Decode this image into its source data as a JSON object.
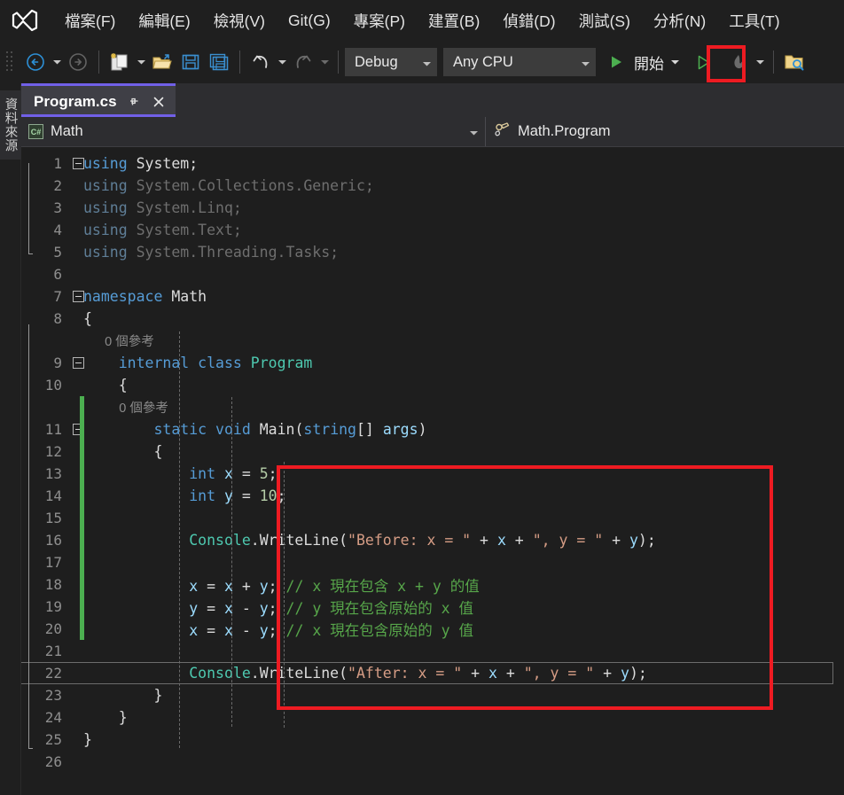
{
  "app": {
    "title": "Visual Studio",
    "logo_icon": "visual-studio-logo"
  },
  "menubar": {
    "items": [
      {
        "label": "檔案(F)"
      },
      {
        "label": "編輯(E)"
      },
      {
        "label": "檢視(V)"
      },
      {
        "label": "Git(G)"
      },
      {
        "label": "專案(P)"
      },
      {
        "label": "建置(B)"
      },
      {
        "label": "偵錯(D)"
      },
      {
        "label": "測試(S)"
      },
      {
        "label": "分析(N)"
      },
      {
        "label": "工具(T)"
      }
    ]
  },
  "toolbar": {
    "grip_icon": "drag-grip-icon",
    "nav_back_icon": "navigate-back-icon",
    "nav_forward_icon": "navigate-forward-icon",
    "new_item_icon": "new-item-icon",
    "open_file_icon": "open-file-icon",
    "save_icon": "save-icon",
    "save_all_icon": "save-all-icon",
    "undo_icon": "undo-icon",
    "redo_icon": "redo-icon",
    "configuration": {
      "label": "Debug",
      "caret_icon": "chevron-down-icon"
    },
    "platform": {
      "label": "Any CPU",
      "caret_icon": "chevron-down-icon"
    },
    "start_debug": {
      "label": "開始",
      "icon": "play-filled-icon",
      "caret_icon": "chevron-down-icon"
    },
    "start_no_debug": {
      "icon": "play-outline-icon",
      "highlighted": true
    },
    "hot_reload": {
      "icon": "hot-reload-flame-icon",
      "caret_icon": "chevron-down-icon"
    },
    "solution_search_icon": "folder-search-icon"
  },
  "highlights": {
    "accent_color": "#ee1b22",
    "run_button_box": "start-without-debugging",
    "code_box": "swap-algorithm-code"
  },
  "sidebar": {
    "vertical_tab_label": "資料來源"
  },
  "tab": {
    "filename": "Program.cs",
    "pin_icon": "pin-icon",
    "close_icon": "close-icon",
    "accent_color": "#7160e8"
  },
  "breadcrumb": {
    "left": {
      "badge": "C#",
      "label": "Math",
      "caret_icon": "chevron-down-icon"
    },
    "right": {
      "icon": "method-class-icon",
      "label": "Math.Program"
    }
  },
  "editor": {
    "background": "#1e1e1e",
    "change_bar_color": "#4caf50",
    "current_line": 22,
    "lines": [
      {
        "n": "1",
        "tokens": [
          {
            "t": "using",
            "c": "kw"
          },
          {
            "t": " System;",
            "c": "plain"
          }
        ]
      },
      {
        "n": "2",
        "tokens": [
          {
            "t": "using",
            "c": "dim"
          },
          {
            "t": " System.Collections.Generic;",
            "c": "dimw"
          }
        ]
      },
      {
        "n": "3",
        "tokens": [
          {
            "t": "using",
            "c": "dim"
          },
          {
            "t": " System.Linq;",
            "c": "dimw"
          }
        ]
      },
      {
        "n": "4",
        "tokens": [
          {
            "t": "using",
            "c": "dim"
          },
          {
            "t": " System.Text;",
            "c": "dimw"
          }
        ]
      },
      {
        "n": "5",
        "tokens": [
          {
            "t": "using",
            "c": "dim"
          },
          {
            "t": " System.Threading.Tasks;",
            "c": "dimw"
          }
        ]
      },
      {
        "n": "6",
        "tokens": []
      },
      {
        "n": "7",
        "tokens": [
          {
            "t": "namespace",
            "c": "kw"
          },
          {
            "t": " Math",
            "c": "plain"
          }
        ]
      },
      {
        "n": "8",
        "tokens": [
          {
            "t": "{",
            "c": "punc"
          }
        ]
      },
      {
        "n": "",
        "codelens": "0 個參考"
      },
      {
        "n": "9",
        "tokens": [
          {
            "t": "    ",
            "c": "plain"
          },
          {
            "t": "internal",
            "c": "kw"
          },
          {
            "t": " ",
            "c": "plain"
          },
          {
            "t": "class",
            "c": "kw"
          },
          {
            "t": " ",
            "c": "plain"
          },
          {
            "t": "Program",
            "c": "type"
          }
        ]
      },
      {
        "n": "10",
        "tokens": [
          {
            "t": "    {",
            "c": "punc"
          }
        ]
      },
      {
        "n": "",
        "codelens": "0 個參考",
        "indent": 2
      },
      {
        "n": "11",
        "tokens": [
          {
            "t": "        ",
            "c": "plain"
          },
          {
            "t": "static",
            "c": "kw"
          },
          {
            "t": " ",
            "c": "plain"
          },
          {
            "t": "void",
            "c": "kw"
          },
          {
            "t": " Main(",
            "c": "plain"
          },
          {
            "t": "string",
            "c": "kw"
          },
          {
            "t": "[] ",
            "c": "plain"
          },
          {
            "t": "args",
            "c": "id"
          },
          {
            "t": ")",
            "c": "plain"
          }
        ]
      },
      {
        "n": "12",
        "tokens": [
          {
            "t": "        {",
            "c": "punc"
          }
        ]
      },
      {
        "n": "13",
        "tokens": [
          {
            "t": "            ",
            "c": "plain"
          },
          {
            "t": "int",
            "c": "kw"
          },
          {
            "t": " ",
            "c": "plain"
          },
          {
            "t": "x",
            "c": "id"
          },
          {
            "t": " = ",
            "c": "plain"
          },
          {
            "t": "5",
            "c": "num"
          },
          {
            "t": ";",
            "c": "plain"
          }
        ]
      },
      {
        "n": "14",
        "tokens": [
          {
            "t": "            ",
            "c": "plain"
          },
          {
            "t": "int",
            "c": "kw"
          },
          {
            "t": " ",
            "c": "plain"
          },
          {
            "t": "y",
            "c": "id"
          },
          {
            "t": " = ",
            "c": "plain"
          },
          {
            "t": "10",
            "c": "num"
          },
          {
            "t": ";",
            "c": "plain"
          }
        ]
      },
      {
        "n": "15",
        "tokens": []
      },
      {
        "n": "16",
        "tokens": [
          {
            "t": "            ",
            "c": "plain"
          },
          {
            "t": "Console",
            "c": "type"
          },
          {
            "t": ".WriteLine(",
            "c": "plain"
          },
          {
            "t": "\"Before: x = \"",
            "c": "str"
          },
          {
            "t": " + ",
            "c": "plain"
          },
          {
            "t": "x",
            "c": "id"
          },
          {
            "t": " + ",
            "c": "plain"
          },
          {
            "t": "\", y = \"",
            "c": "str"
          },
          {
            "t": " + ",
            "c": "plain"
          },
          {
            "t": "y",
            "c": "id"
          },
          {
            "t": ");",
            "c": "plain"
          }
        ]
      },
      {
        "n": "17",
        "tokens": []
      },
      {
        "n": "18",
        "tokens": [
          {
            "t": "            ",
            "c": "plain"
          },
          {
            "t": "x",
            "c": "id"
          },
          {
            "t": " = ",
            "c": "plain"
          },
          {
            "t": "x",
            "c": "id"
          },
          {
            "t": " + ",
            "c": "plain"
          },
          {
            "t": "y",
            "c": "id"
          },
          {
            "t": "; ",
            "c": "plain"
          },
          {
            "t": "// x 現在包含 x + y 的值",
            "c": "cmt"
          }
        ]
      },
      {
        "n": "19",
        "tokens": [
          {
            "t": "            ",
            "c": "plain"
          },
          {
            "t": "y",
            "c": "id"
          },
          {
            "t": " = ",
            "c": "plain"
          },
          {
            "t": "x",
            "c": "id"
          },
          {
            "t": " - ",
            "c": "plain"
          },
          {
            "t": "y",
            "c": "id"
          },
          {
            "t": "; ",
            "c": "plain"
          },
          {
            "t": "// y 現在包含原始的 x 值",
            "c": "cmt"
          }
        ]
      },
      {
        "n": "20",
        "tokens": [
          {
            "t": "            ",
            "c": "plain"
          },
          {
            "t": "x",
            "c": "id"
          },
          {
            "t": " = ",
            "c": "plain"
          },
          {
            "t": "x",
            "c": "id"
          },
          {
            "t": " - ",
            "c": "plain"
          },
          {
            "t": "y",
            "c": "id"
          },
          {
            "t": "; ",
            "c": "plain"
          },
          {
            "t": "// x 現在包含原始的 y 值",
            "c": "cmt"
          }
        ]
      },
      {
        "n": "21",
        "tokens": []
      },
      {
        "n": "22",
        "tokens": [
          {
            "t": "            ",
            "c": "plain"
          },
          {
            "t": "Console",
            "c": "type"
          },
          {
            "t": ".WriteLine(",
            "c": "plain"
          },
          {
            "t": "\"After: x = \"",
            "c": "str"
          },
          {
            "t": " + ",
            "c": "plain"
          },
          {
            "t": "x",
            "c": "id"
          },
          {
            "t": " + ",
            "c": "plain"
          },
          {
            "t": "\", y = \"",
            "c": "str"
          },
          {
            "t": " + ",
            "c": "plain"
          },
          {
            "t": "y",
            "c": "id"
          },
          {
            "t": ");",
            "c": "plain"
          }
        ],
        "current": true
      },
      {
        "n": "23",
        "tokens": [
          {
            "t": "        }",
            "c": "punc"
          }
        ]
      },
      {
        "n": "24",
        "tokens": [
          {
            "t": "    }",
            "c": "punc"
          }
        ]
      },
      {
        "n": "25",
        "tokens": [
          {
            "t": "}",
            "c": "punc"
          }
        ]
      },
      {
        "n": "26",
        "tokens": []
      }
    ]
  }
}
